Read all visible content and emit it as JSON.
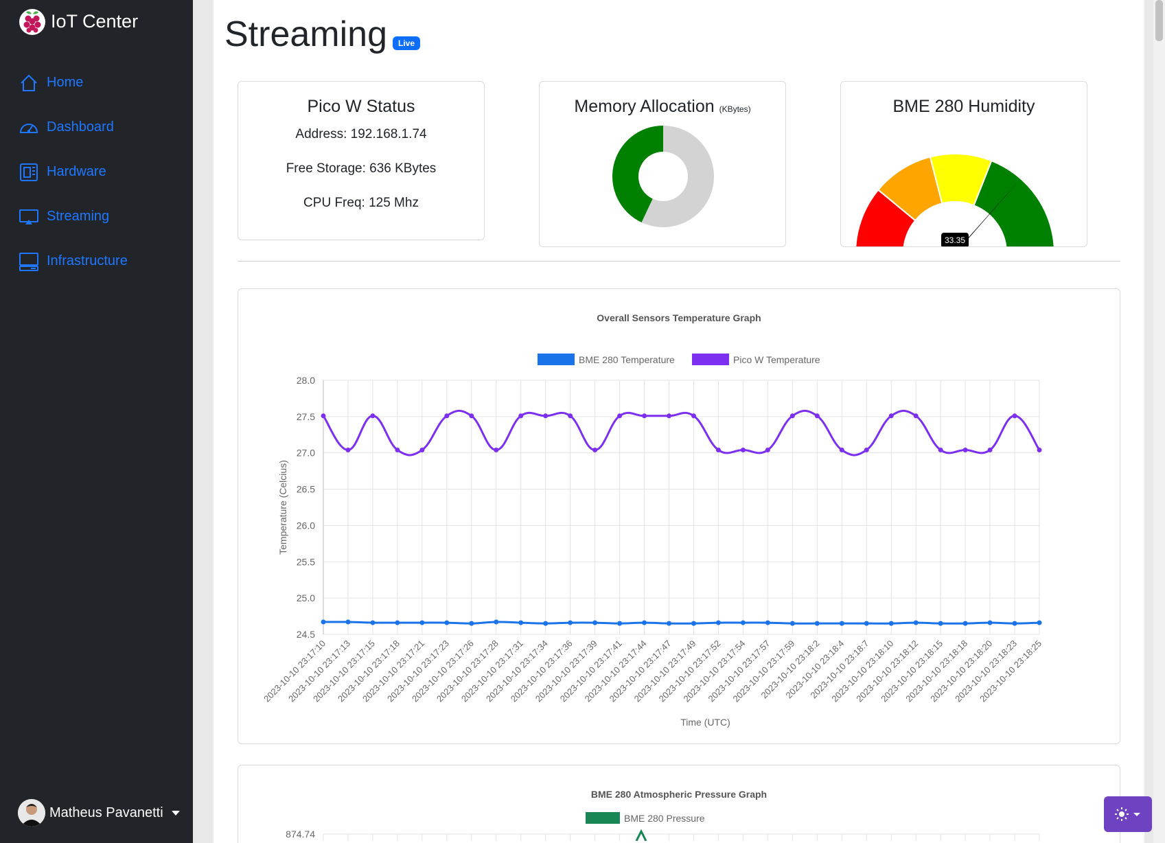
{
  "sidebar": {
    "brand": "IoT Center",
    "items": [
      {
        "label": "Home",
        "icon": "home-icon"
      },
      {
        "label": "Dashboard",
        "icon": "speedometer-icon"
      },
      {
        "label": "Hardware",
        "icon": "cpu-icon"
      },
      {
        "label": "Streaming",
        "icon": "display-icon"
      },
      {
        "label": "Infrastructure",
        "icon": "server-icon"
      }
    ],
    "user": "Matheus Pavanetti"
  },
  "main": {
    "title": "Streaming",
    "badge": "Live",
    "status": {
      "title": "Pico W Status",
      "address": "Address: 192.168.1.74",
      "storage": "Free Storage: 636 KBytes",
      "cpu": "CPU Freq: 125 Mhz"
    },
    "memory": {
      "title": "Memory Allocation",
      "unit": "(KBytes)",
      "used_fraction": 0.43,
      "used_color": "#008000",
      "free_color": "#d3d3d3"
    },
    "humidity": {
      "title": "BME 280 Humidity",
      "value": "33.35",
      "value_num": 33.35,
      "max": 100,
      "colors": [
        "#ff0000",
        "#ffa500",
        "#ffff00",
        "#008000"
      ]
    }
  },
  "chart_data": [
    {
      "type": "line",
      "title": "Overall Sensors Temperature Graph",
      "xlabel": "Time (UTC)",
      "ylabel": "Temperature (Celcius)",
      "ylim": [
        24.5,
        28.0
      ],
      "yticks": [
        "28.0",
        "27.5",
        "27.0",
        "26.5",
        "26.0",
        "25.5",
        "25.0",
        "24.5"
      ],
      "legend_position": "top",
      "grid": true,
      "categories": [
        "2023-10-10 23:17:10",
        "2023-10-10 23:17:13",
        "2023-10-10 23:17:15",
        "2023-10-10 23:17:18",
        "2023-10-10 23:17:21",
        "2023-10-10 23:17:23",
        "2023-10-10 23:17:26",
        "2023-10-10 23:17:28",
        "2023-10-10 23:17:31",
        "2023-10-10 23:17:34",
        "2023-10-10 23:17:36",
        "2023-10-10 23:17:39",
        "2023-10-10 23:17:41",
        "2023-10-10 23:17:44",
        "2023-10-10 23:17:47",
        "2023-10-10 23:17:49",
        "2023-10-10 23:17:52",
        "2023-10-10 23:17:54",
        "2023-10-10 23:17:57",
        "2023-10-10 23:17:59",
        "2023-10-10 23:18:2",
        "2023-10-10 23:18:4",
        "2023-10-10 23:18:7",
        "2023-10-10 23:18:10",
        "2023-10-10 23:18:12",
        "2023-10-10 23:18:15",
        "2023-10-10 23:18:18",
        "2023-10-10 23:18:20",
        "2023-10-10 23:18:23",
        "2023-10-10 23:18:25"
      ],
      "series": [
        {
          "name": "BME 280 Temperature",
          "color": "#1a73e8",
          "values": [
            24.67,
            24.67,
            24.66,
            24.66,
            24.66,
            24.66,
            24.65,
            24.67,
            24.66,
            24.65,
            24.66,
            24.66,
            24.65,
            24.66,
            24.65,
            24.65,
            24.66,
            24.66,
            24.66,
            24.65,
            24.65,
            24.65,
            24.65,
            24.65,
            24.66,
            24.65,
            24.65,
            24.66,
            24.65,
            24.66
          ]
        },
        {
          "name": "Pico W Temperature",
          "color": "#7c2ff0",
          "values": [
            27.51,
            27.04,
            27.51,
            27.04,
            27.04,
            27.51,
            27.51,
            27.04,
            27.51,
            27.51,
            27.51,
            27.04,
            27.51,
            27.51,
            27.51,
            27.51,
            27.04,
            27.04,
            27.04,
            27.51,
            27.51,
            27.04,
            27.04,
            27.51,
            27.51,
            27.04,
            27.04,
            27.04,
            27.51,
            27.04
          ]
        }
      ]
    },
    {
      "type": "line",
      "title": "BME 280 Atmospheric Pressure Graph",
      "legend_position": "top",
      "grid": true,
      "yticks": [
        "874.74"
      ],
      "series": [
        {
          "name": "BME 280 Pressure",
          "color": "#198754"
        }
      ]
    }
  ]
}
